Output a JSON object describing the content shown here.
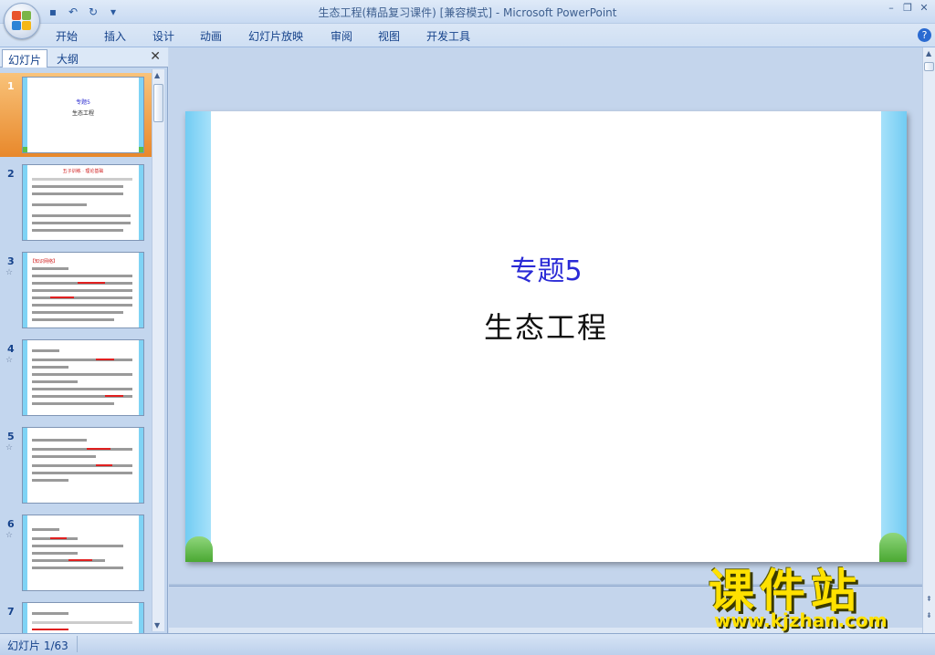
{
  "window": {
    "title": "生态工程(精品复习课件) [兼容模式] - Microsoft PowerPoint"
  },
  "ribbon": {
    "tabs": [
      "开始",
      "插入",
      "设计",
      "动画",
      "幻灯片放映",
      "审阅",
      "视图",
      "开发工具"
    ]
  },
  "left_panel": {
    "tab_slides": "幻灯片",
    "tab_outline": "大纲",
    "close": "✕",
    "thumbnails": [
      {
        "num": "1",
        "title": "专题5",
        "subtitle": "生态工程"
      },
      {
        "num": "2",
        "header": "五子训练 · 理论基础"
      },
      {
        "num": "3",
        "header": "【知识网络】"
      },
      {
        "num": "4"
      },
      {
        "num": "5"
      },
      {
        "num": "6"
      },
      {
        "num": "7"
      }
    ]
  },
  "slide": {
    "title": "专题5",
    "subtitle": "生态工程"
  },
  "status": {
    "slide_counter": "幻灯片 1/63"
  },
  "watermark": {
    "text": "课件站",
    "url": "www.kjzhan.com"
  }
}
